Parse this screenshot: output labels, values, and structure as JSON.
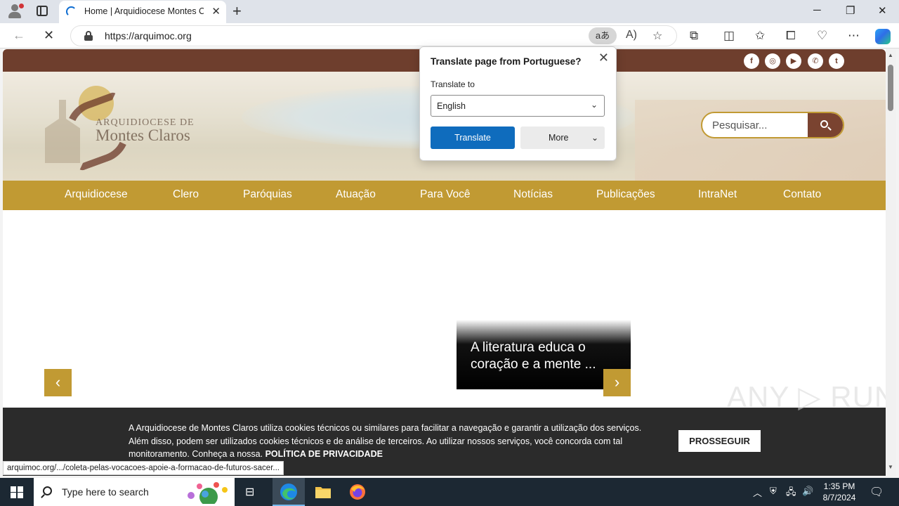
{
  "browser": {
    "tab_title": "Home | Arquidiocese Montes Claros",
    "url": "https://arquimoc.org",
    "translate_icon": "aあ",
    "status_url": "arquimoc.org/.../coleta-pelas-vocacoes-apoie-a-formacao-de-futuros-sacer..."
  },
  "translate_popup": {
    "heading": "Translate page from Portuguese?",
    "label": "Translate to",
    "language": "English",
    "translate_button": "Translate",
    "more_button": "More"
  },
  "site": {
    "logo_line1": "ARQUIDIOCESE DE",
    "logo_line2": "Montes Claros",
    "search_placeholder": "Pesquisar...",
    "social": [
      "f",
      "◎",
      "▶",
      "✆",
      "t"
    ],
    "nav": [
      "Arquidiocese",
      "Clero",
      "Paróquias",
      "Atuação",
      "Para Você",
      "Notícias",
      "Publicações",
      "IntraNet",
      "Contato"
    ],
    "slide_title": "A literatura educa o coração e a mente ...",
    "cookie_text": "A Arquidiocese de Montes Claros utiliza cookies técnicos ou similares para facilitar a navegação e garantir a utilização dos serviços. Além disso, podem ser utilizados cookies técnicos e de análise de terceiros. Ao utilizar nossos serviços, você concorda com tal monitoramento. Conheça a nossa.",
    "cookie_link": "POLÍTICA DE PRIVACIDADE",
    "cookie_button": "PROSSEGUIR",
    "brand_color": "#c19a33",
    "top_color": "#6e3e2d"
  },
  "watermark": "ANY ▷ RUN",
  "taskbar": {
    "search_placeholder": "Type here to search",
    "time": "1:35 PM",
    "date": "8/7/2024"
  }
}
